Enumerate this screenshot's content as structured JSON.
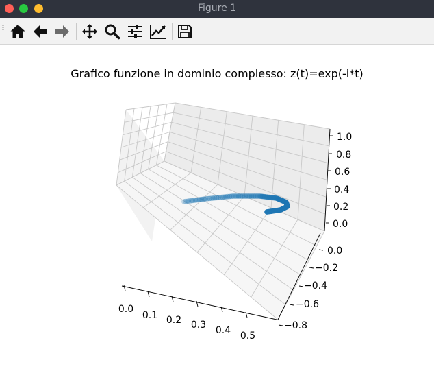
{
  "window": {
    "title": "Figure 1"
  },
  "toolbar": {
    "buttons": [
      {
        "name": "home-button",
        "icon": "home-icon",
        "tooltip": "Home"
      },
      {
        "name": "back-button",
        "icon": "arrow-left-icon",
        "tooltip": "Back"
      },
      {
        "name": "forward-button",
        "icon": "arrow-right-icon",
        "tooltip": "Forward"
      },
      {
        "name": "pan-button",
        "icon": "move-icon",
        "tooltip": "Pan"
      },
      {
        "name": "zoom-button",
        "icon": "magnifier-icon",
        "tooltip": "Zoom"
      },
      {
        "name": "subplots-button",
        "icon": "sliders-icon",
        "tooltip": "Subplots"
      },
      {
        "name": "customize-button",
        "icon": "chart-line-icon",
        "tooltip": "Customize"
      },
      {
        "name": "save-button",
        "icon": "floppy-disk-icon",
        "tooltip": "Save"
      }
    ]
  },
  "figure": {
    "title": "Grafico funzione in dominio complesso: z(t)=exp(-i*t)"
  },
  "chart_data": {
    "type": "scatter",
    "projection": "3d",
    "title": "Grafico funzione in dominio complesso: z(t)=exp(-i*t)",
    "color": "#1f77b4",
    "marker": "o",
    "grid": true,
    "axes": {
      "x": {
        "ticks": [
          "0.0",
          "0.1",
          "0.2",
          "0.3",
          "0.4",
          "0.5"
        ],
        "lim": [
          0.0,
          0.55
        ]
      },
      "y": {
        "ticks": [
          "0.0",
          "−0.2",
          "−0.4",
          "−0.6",
          "−0.8"
        ],
        "lim": [
          -0.85,
          0.05
        ]
      },
      "z": {
        "ticks": [
          "0.0",
          "0.2",
          "0.4",
          "0.6",
          "0.8",
          "1.0"
        ],
        "lim": [
          0.0,
          1.05
        ]
      }
    },
    "points_description": "Spiral of markers: x = Re(z), y = Im(z), z = t, t from 0 to 1"
  }
}
